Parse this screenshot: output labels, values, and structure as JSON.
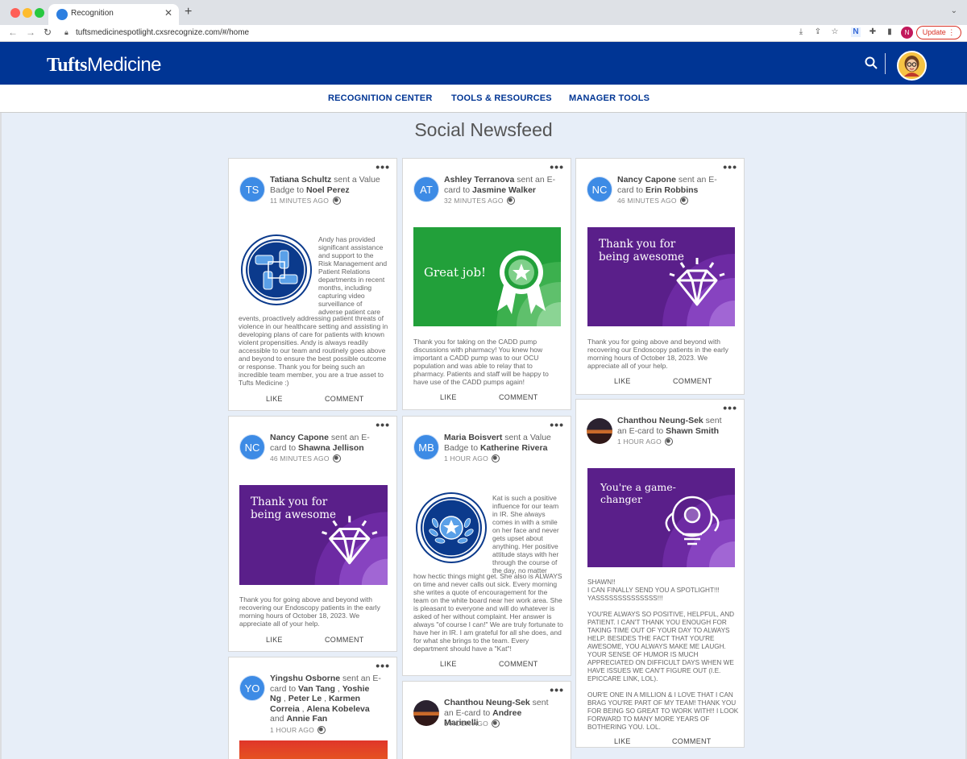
{
  "browser": {
    "tab_title": "Recognition",
    "url": "tuftsmedicinespotlight.cxsrecognize.com/#/home",
    "update_label": "Update",
    "profile_initial": "N"
  },
  "header": {
    "logo_bold": "Tufts",
    "logo_regular": "Medicine"
  },
  "nav": {
    "items": [
      "RECOGNITION CENTER",
      "TOOLS & RESOURCES",
      "MANAGER TOOLS"
    ]
  },
  "page": {
    "title": "Social Newsfeed"
  },
  "actions": {
    "like": "LIKE",
    "comment": "COMMENT"
  },
  "cards": [
    {
      "initials": "TS",
      "sender": "Tatiana Schultz",
      "verb": "sent a Value Badge to",
      "recipient": "Noel Perez",
      "time": "11 MINUTES AGO",
      "msg_side": "Andy has provided significant assistance and support to the Risk Management and Patient Relations departments in recent months, including capturing video surveillance of adverse patient care",
      "msg_full": "events, proactively addressing patient threats of violence in our healthcare setting and assisting in developing plans of care for patients with known violent propensities. Andy is always readily accessible to our team and routinely goes above and beyond to ensure the best possible outcome or response. Thank you for being such an incredible team member, you are a true asset to Tufts Medicine :)"
    },
    {
      "initials": "AT",
      "sender": "Ashley Terranova",
      "verb": "sent an E-card to",
      "recipient": "Jasmine Walker",
      "time": "32 MINUTES AGO",
      "ecard_text": "Great job!",
      "msg": "Thank you for taking on the CADD pump discussions with pharmacy! You knew how important a CADD pump was to our OCU population and was able to relay that to pharmacy. Patients and staff will be happy to have use of the CADD pumps again!"
    },
    {
      "initials": "NC",
      "sender": "Nancy Capone",
      "verb": "sent an E-card to",
      "recipient": "Erin Robbins",
      "time": "46 MINUTES AGO",
      "ecard_text": "Thank you for being awesome",
      "msg": "Thank you for going above and beyond with recovering our Endoscopy patients in the early morning hours of October 18, 2023. We appreciate all of your help."
    },
    {
      "initials": "NC",
      "sender": "Nancy Capone",
      "verb": "sent an E-card to",
      "recipient": "Shawna Jellison",
      "time": "46 MINUTES AGO",
      "ecard_text": "Thank you for being awesome",
      "msg": "Thank you for going above and beyond with recovering our Endoscopy patients in the early morning hours of October 18, 2023. We appreciate all of your help."
    },
    {
      "initials": "MB",
      "sender": "Maria Boisvert",
      "verb": "sent a Value Badge to",
      "recipient": "Katherine Rivera",
      "time": "1 HOUR AGO",
      "msg_side": "Kat is such a positive influence for our team in IR. She always comes in with a smile on her face and never gets upset about anything. Her positive attitude stays with her through the course of the day, no matter",
      "msg_full": "how hectic things might get. She also is ALWAYS on time and never calls out sick. Every morning she writes a quote of encouragement for the team on the white board near her work area. She is pleasant to everyone and will do whatever is asked of her without complaint. Her answer is always \"of course I can!\" We are truly fortunate to have her in IR. I am grateful for all she does, and for what she brings to the team. Every department should have a \"Kat\"!"
    },
    {
      "sender": "Chanthou Neung-Sek",
      "verb": "sent an E-card to",
      "recipient": "Shawn Smith",
      "time": "1 HOUR AGO",
      "ecard_text": "You're a game-changer",
      "msg": "SHAWN!!\nI CAN FINALLY SEND YOU A SPOTLIGHT!!!\nYASSSSSSSSSSSSSS!!!\n\nYOU'RE ALWAYS SO POSITIVE, HELPFUL, AND PATIENT. I CAN'T THANK YOU ENOUGH FOR TAKING TIME OUT OF YOUR DAY TO ALWAYS HELP. BESIDES THE FACT THAT YOU'RE AWESOME, YOU ALWAYS MAKE ME LAUGH. YOUR SENSE OF HUMOR IS MUCH APPRECIATED ON DIFFICULT DAYS WHEN WE HAVE ISSUES WE CAN'T FIGURE OUT (I.E. EPICCARE LINK, LOL).\n\nOUR'E ONE IN A MILLION & I LOVE THAT I CAN BRAG YOU'RE PART OF MY TEAM! THANK YOU FOR BEING SO GREAT TO WORK WITH!! I LOOK FORWARD TO MANY MORE YEARS OF BOTHERING YOU. LOL."
    },
    {
      "initials": "YO",
      "sender": "Yingshu Osborne",
      "verb": "sent an E-card to",
      "recipients": [
        "Van Tang",
        "Yoshie Ng",
        "Peter Le",
        "Karmen Correia",
        "Alena Kobeleva",
        "Annie Fan"
      ],
      "conj": "and",
      "time": "1 HOUR AGO"
    },
    {
      "sender": "Chanthou Neung-Sek",
      "verb": "sent an E-card to",
      "recipient": "Andree Marinelli",
      "time": "1 HOUR AGO"
    }
  ]
}
